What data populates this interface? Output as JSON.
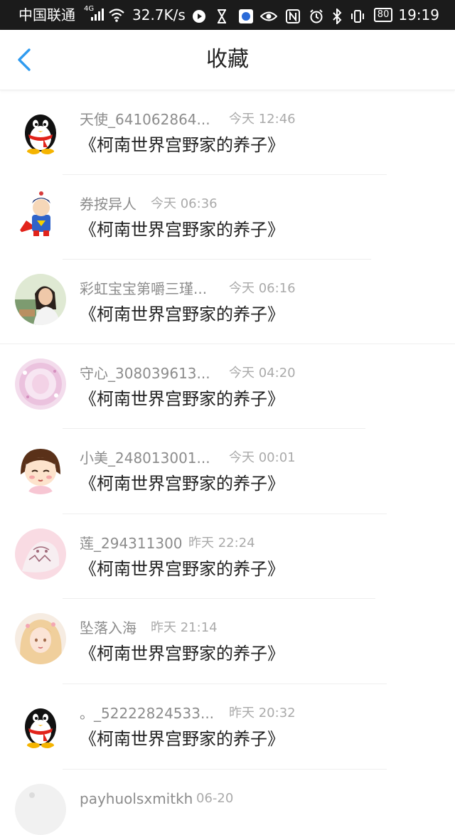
{
  "status_bar": {
    "carrier": "中国联通",
    "network": "4G",
    "speed": "32.7K/s",
    "battery": "80",
    "time": "19:19"
  },
  "header": {
    "title": "收藏"
  },
  "items": [
    {
      "name": "天使_641062864...",
      "time": "今天 12:46",
      "title": "《柯南世界宫野家的养子》",
      "avatar": "qq-penguin"
    },
    {
      "name": "券按异人",
      "time": "今天 06:36",
      "title": "《柯南世界宫野家的养子》",
      "avatar": "cartoon-superhero"
    },
    {
      "name": "彩虹宝宝第嚼三瑾...",
      "time": "今天 06:16",
      "title": "《柯南世界宫野家的养子》",
      "avatar": "photo-girl"
    },
    {
      "name": "守心_308039613...",
      "time": "今天 04:20",
      "title": "《柯南世界宫野家的养子》",
      "avatar": "pink-anime"
    },
    {
      "name": "小美_248013001...",
      "time": "今天 00:01",
      "title": "《柯南世界宫野家的养子》",
      "avatar": "cartoon-girl"
    },
    {
      "name": "莲_294311300",
      "time": "昨天 22:24",
      "title": "《柯南世界宫野家的养子》",
      "avatar": "pink-sketch"
    },
    {
      "name": "坠落入海",
      "time": "昨天 21:14",
      "title": "《柯南世界宫野家的养子》",
      "avatar": "anime-blonde"
    },
    {
      "name": "。_52222824533...",
      "time": "昨天 20:32",
      "title": "《柯南世界宫野家的养子》",
      "avatar": "qq-penguin"
    },
    {
      "name": "payhuolsxmitkh",
      "time": "06-20",
      "title": "",
      "avatar": "blank"
    }
  ]
}
